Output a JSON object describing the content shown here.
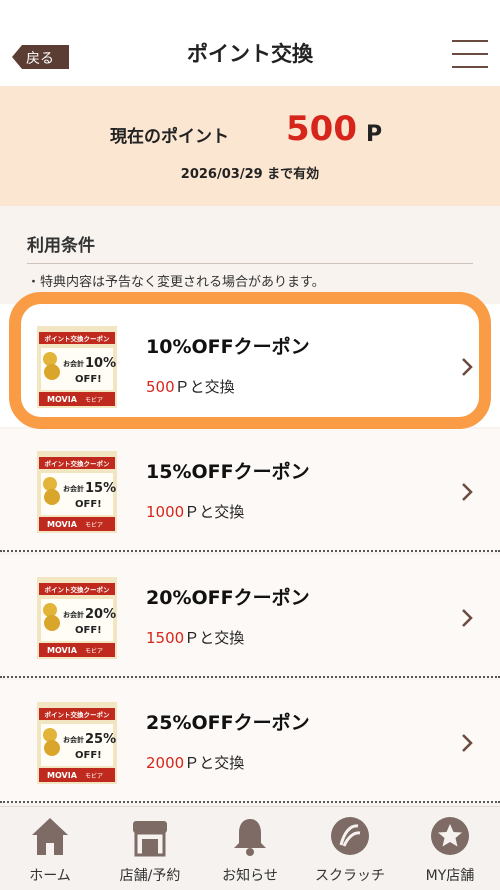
{
  "header": {
    "back_label": "戻る",
    "title": "ポイント交換"
  },
  "points": {
    "label": "現在のポイント",
    "value": "500",
    "unit": "P",
    "expiry": "2026/03/29 まで有効"
  },
  "conditions": {
    "title": "利用条件",
    "notice": "・特典内容は予告なく変更される場合があります。"
  },
  "thumbnail": {
    "banner": "ポイント交換クーポン",
    "prefix": "お会計",
    "off": "OFF!",
    "brand": "MOVIA",
    "brand_sub": "モビア"
  },
  "coupons": [
    {
      "name": "10%OFFクーポン",
      "percent": "10%",
      "points": "500",
      "suffix": "Ｐと交換"
    },
    {
      "name": "15%OFFクーポン",
      "percent": "15%",
      "points": "1000",
      "suffix": "Ｐと交換"
    },
    {
      "name": "20%OFFクーポン",
      "percent": "20%",
      "points": "1500",
      "suffix": "Ｐと交換"
    },
    {
      "name": "25%OFFクーポン",
      "percent": "25%",
      "points": "2000",
      "suffix": "Ｐと交換"
    }
  ],
  "tabs": [
    {
      "label": "ホーム",
      "icon": "home-icon"
    },
    {
      "label": "店舗/予約",
      "icon": "store-icon"
    },
    {
      "label": "お知らせ",
      "icon": "bell-icon"
    },
    {
      "label": "スクラッチ",
      "icon": "scratch-icon"
    },
    {
      "label": "MY店舗",
      "icon": "star-icon"
    }
  ],
  "colors": {
    "accent_red": "#d6261c",
    "brown": "#6b4a3f",
    "highlight_orange": "#fa9c45",
    "points_panel": "#fbe6d2"
  }
}
